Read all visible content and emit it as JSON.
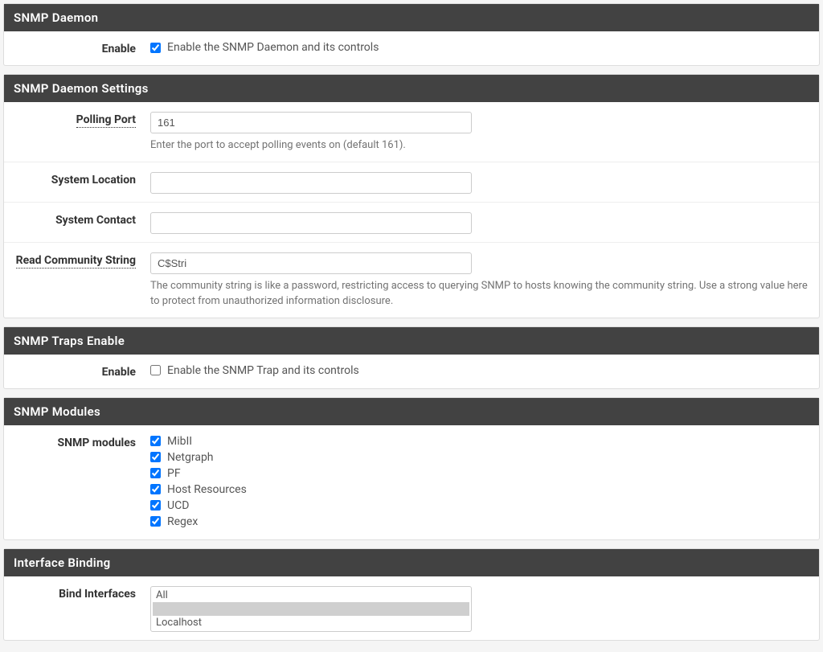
{
  "snmp_daemon": {
    "header": "SNMP Daemon",
    "enable_label": "Enable",
    "enable_text": "Enable the SNMP Daemon and its controls",
    "enable_checked": true
  },
  "snmp_daemon_settings": {
    "header": "SNMP Daemon Settings",
    "polling_port_label": "Polling Port",
    "polling_port_value": "161",
    "polling_port_help": "Enter the port to accept polling events on (default 161).",
    "system_location_label": "System Location",
    "system_location_value": "",
    "system_contact_label": "System Contact",
    "system_contact_value": "",
    "read_community_label": "Read Community String",
    "read_community_value": "C$Stri",
    "read_community_help": "The community string is like a password, restricting access to querying SNMP to hosts knowing the community string. Use a strong value here to protect from unauthorized information disclosure."
  },
  "snmp_traps": {
    "header": "SNMP Traps Enable",
    "enable_label": "Enable",
    "enable_text": "Enable the SNMP Trap and its controls",
    "enable_checked": false
  },
  "snmp_modules": {
    "header": "SNMP Modules",
    "label": "SNMP modules",
    "items": [
      {
        "label": "MibII",
        "checked": true
      },
      {
        "label": "Netgraph",
        "checked": true
      },
      {
        "label": "PF",
        "checked": true
      },
      {
        "label": "Host Resources",
        "checked": true
      },
      {
        "label": "UCD",
        "checked": true
      },
      {
        "label": "Regex",
        "checked": true
      }
    ]
  },
  "interface_binding": {
    "header": "Interface Binding",
    "label": "Bind Interfaces",
    "options": [
      {
        "label": "All",
        "selected": false
      },
      {
        "label": " ",
        "selected": true
      },
      {
        "label": "Localhost",
        "selected": false
      }
    ]
  }
}
